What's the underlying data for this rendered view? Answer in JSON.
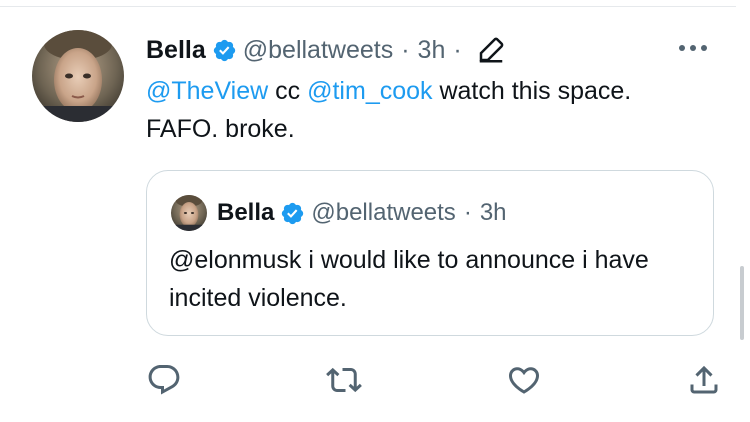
{
  "tweet": {
    "author": {
      "display_name": "Bella",
      "handle": "@bellatweets",
      "verified": true
    },
    "separator": "·",
    "timestamp": "3h",
    "trailing_separator": "·",
    "text": {
      "mention1": "@TheView",
      "cc": " cc ",
      "mention2": "@tim_cook",
      "rest": " watch this space. FAFO. broke."
    },
    "icons": {
      "verified": "verified-badge-icon",
      "edit": "edit-pencil-icon",
      "more": "more-options-icon"
    }
  },
  "quoted_tweet": {
    "author": {
      "display_name": "Bella",
      "handle": "@bellatweets",
      "verified": true
    },
    "separator": "·",
    "timestamp": "3h",
    "text": "@elonmusk i would like to announce i have incited violence."
  },
  "actions": [
    {
      "name": "reply",
      "icon": "reply-icon"
    },
    {
      "name": "retweet",
      "icon": "retweet-icon"
    },
    {
      "name": "like",
      "icon": "like-icon"
    },
    {
      "name": "share",
      "icon": "share-icon"
    }
  ],
  "colors": {
    "link": "#1d9bf0",
    "verified": "#1d9bf0",
    "secondary_text": "#536471",
    "primary_text": "#0f1419",
    "border": "#cfd9de"
  }
}
